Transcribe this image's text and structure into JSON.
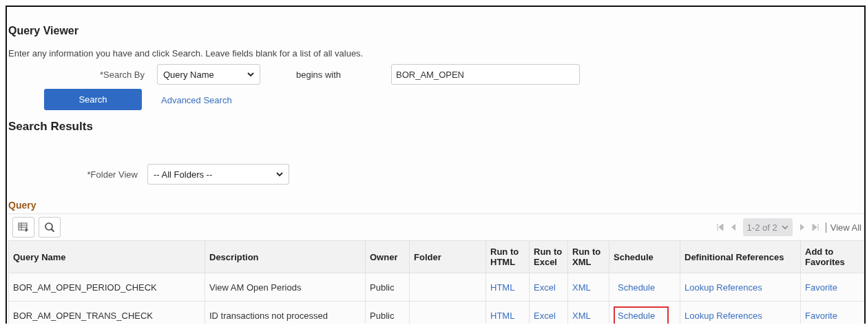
{
  "page": {
    "title": "Query Viewer",
    "instructions": "Enter any information you have and click Search. Leave fields blank for a list of all values."
  },
  "search": {
    "search_by_label": "*Search By",
    "search_by_value": "Query Name",
    "operator": "begins with",
    "value": "BOR_AM_OPEN",
    "search_button": "Search",
    "advanced_link": "Advanced Search"
  },
  "results": {
    "title": "Search Results",
    "folder_label": "*Folder View",
    "folder_value": "-- All Folders --",
    "grid_title": "Query",
    "pager": {
      "range": "1-2 of 2",
      "view_all": "View All"
    },
    "columns": [
      "Query Name",
      "Description",
      "Owner",
      "Folder",
      "Run to HTML",
      "Run to Excel",
      "Run to XML",
      "Schedule",
      "Definitional References",
      "Add to Favorites"
    ],
    "rows": [
      {
        "query_name": "BOR_AM_OPEN_PERIOD_CHECK",
        "description": "View AM Open Periods",
        "owner": "Public",
        "folder": "",
        "html": "HTML",
        "excel": "Excel",
        "xml": "XML",
        "schedule": "Schedule",
        "references": "Lookup References",
        "favorite": "Favorite",
        "highlighted": false
      },
      {
        "query_name": "BOR_AM_OPEN_TRANS_CHECK",
        "description": "ID transactions not processed",
        "owner": "Public",
        "folder": "",
        "html": "HTML",
        "excel": "Excel",
        "xml": "XML",
        "schedule": "Schedule",
        "references": "Lookup References",
        "favorite": "Favorite",
        "highlighted": true
      }
    ]
  }
}
